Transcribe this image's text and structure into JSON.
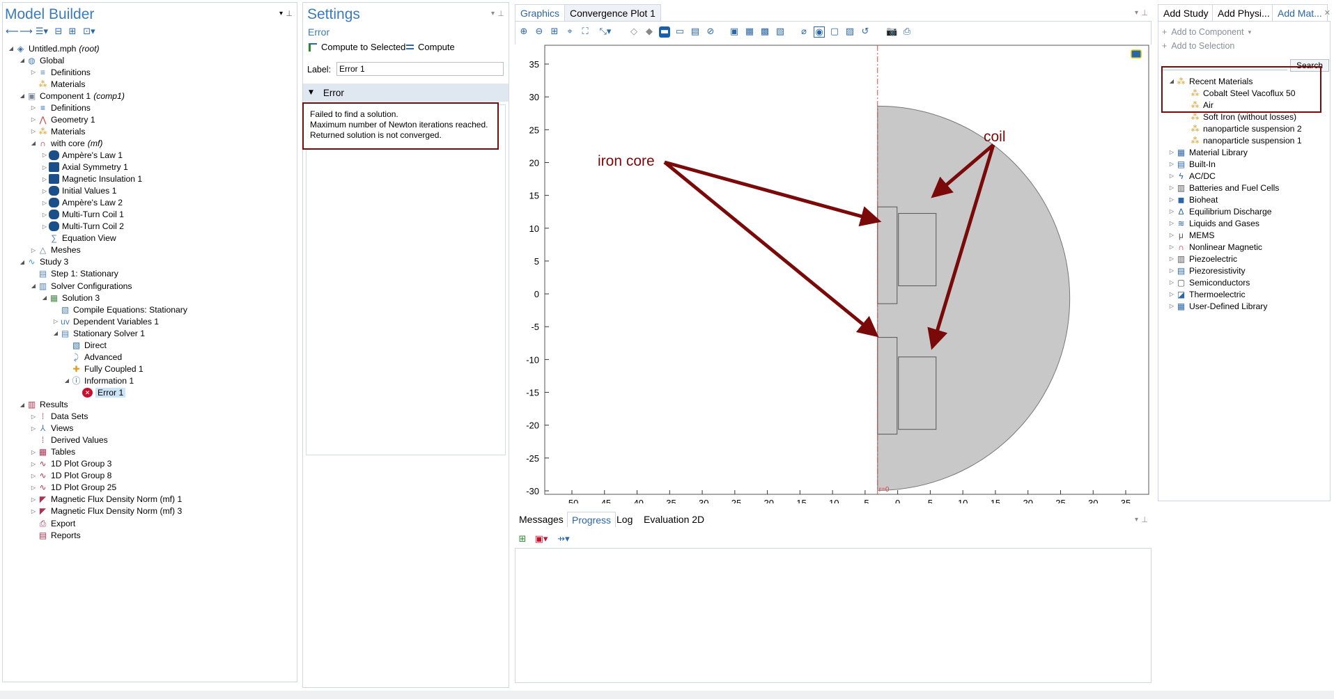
{
  "model_builder": {
    "title": "Model Builder",
    "tree": [
      {
        "label": "Untitled.mph",
        "suffix": "(root)",
        "level": 0,
        "twist": "open",
        "icon": "root-icon",
        "color": "#3a6ea5"
      },
      {
        "label": "Global",
        "level": 1,
        "twist": "open",
        "icon": "globe-icon",
        "color": "#4a7fb8"
      },
      {
        "label": "Definitions",
        "level": 2,
        "twist": "closed",
        "icon": "definitions-icon",
        "color": "#4a7fb8"
      },
      {
        "label": "Materials",
        "level": 2,
        "twist": "none",
        "icon": "materials-icon",
        "color": "#e69a1e"
      },
      {
        "label": "Component 1",
        "suffix": "(comp1)",
        "level": 1,
        "twist": "open",
        "icon": "component-icon",
        "color": "#7a8796"
      },
      {
        "label": "Definitions",
        "level": 2,
        "twist": "closed",
        "icon": "definitions-icon",
        "color": "#2a66a8"
      },
      {
        "label": "Geometry 1",
        "level": 2,
        "twist": "closed",
        "icon": "geometry-icon",
        "color": "#d23b2a"
      },
      {
        "label": "Materials",
        "level": 2,
        "twist": "closed",
        "icon": "materials-icon",
        "color": "#e69a1e"
      },
      {
        "label": "with core",
        "suffix": "(mf)",
        "level": 2,
        "twist": "open",
        "icon": "magnet-icon",
        "color": "#c8102e"
      },
      {
        "label": "Ampère's Law 1",
        "level": 3,
        "twist": "closed",
        "icon": "domain-node-icon",
        "color": "#1b4f8a"
      },
      {
        "label": "Axial Symmetry 1",
        "level": 3,
        "twist": "closed",
        "icon": "boundary-node-icon",
        "color": "#1b4f8a"
      },
      {
        "label": "Magnetic Insulation 1",
        "level": 3,
        "twist": "closed",
        "icon": "boundary-node-icon",
        "color": "#1b4f8a"
      },
      {
        "label": "Initial Values 1",
        "level": 3,
        "twist": "closed",
        "icon": "domain-node-icon",
        "color": "#1b4f8a"
      },
      {
        "label": "Ampère's Law 2",
        "level": 3,
        "twist": "closed",
        "icon": "domain-node-icon",
        "color": "#1b4f8a"
      },
      {
        "label": "Multi-Turn Coil 1",
        "level": 3,
        "twist": "closed",
        "icon": "domain-node-icon",
        "color": "#1b4f8a"
      },
      {
        "label": "Multi-Turn Coil 2",
        "level": 3,
        "twist": "closed",
        "icon": "domain-node-icon",
        "color": "#1b4f8a"
      },
      {
        "label": "Equation View",
        "level": 3,
        "twist": "none",
        "icon": "equation-view-icon",
        "color": "#4a7fb8"
      },
      {
        "label": "Meshes",
        "level": 2,
        "twist": "closed",
        "icon": "mesh-icon",
        "color": "#6b7b8c"
      },
      {
        "label": "Study 3",
        "level": 1,
        "twist": "open",
        "icon": "study-icon",
        "color": "#3a9ad9"
      },
      {
        "label": "Step 1: Stationary",
        "level": 2,
        "twist": "none",
        "icon": "step-icon",
        "color": "#4a7fb8"
      },
      {
        "label": "Solver Configurations",
        "level": 2,
        "twist": "open",
        "icon": "solver-config-icon",
        "color": "#4a7fb8"
      },
      {
        "label": "Solution 3",
        "level": 3,
        "twist": "open",
        "icon": "solution-icon",
        "color": "#4a8a4a"
      },
      {
        "label": "Compile Equations: Stationary",
        "level": 4,
        "twist": "none",
        "icon": "compile-icon",
        "color": "#4a7fb8"
      },
      {
        "label": "Dependent Variables 1",
        "level": 4,
        "twist": "closed",
        "icon": "dependent-variables-icon",
        "color": "#4a7fb8"
      },
      {
        "label": "Stationary Solver 1",
        "level": 4,
        "twist": "open",
        "icon": "stationary-solver-icon",
        "color": "#4a7fb8"
      },
      {
        "label": "Direct",
        "level": 5,
        "twist": "none",
        "icon": "direct-icon",
        "color": "#2a66a8"
      },
      {
        "label": "Advanced",
        "level": 5,
        "twist": "none",
        "icon": "advanced-icon",
        "color": "#4a7fb8"
      },
      {
        "label": "Fully Coupled 1",
        "level": 5,
        "twist": "none",
        "icon": "fully-coupled-icon",
        "color": "#e69a1e"
      },
      {
        "label": "Information 1",
        "level": 5,
        "twist": "open",
        "icon": "information-icon",
        "color": "#2a66a8"
      },
      {
        "label": "Error 1",
        "level": 6,
        "twist": "none",
        "icon": "error-icon",
        "color": "#c8102e",
        "selected": true
      },
      {
        "label": "Results",
        "level": 1,
        "twist": "open",
        "icon": "results-icon",
        "color": "#b03050"
      },
      {
        "label": "Data Sets",
        "level": 2,
        "twist": "closed",
        "icon": "data-sets-icon",
        "color": "#b03050"
      },
      {
        "label": "Views",
        "level": 2,
        "twist": "closed",
        "icon": "views-icon",
        "color": "#4a7fb8"
      },
      {
        "label": "Derived Values",
        "level": 2,
        "twist": "none",
        "icon": "derived-values-icon",
        "color": "#b03050"
      },
      {
        "label": "Tables",
        "level": 2,
        "twist": "closed",
        "icon": "tables-icon",
        "color": "#b03050"
      },
      {
        "label": "1D Plot Group 3",
        "level": 2,
        "twist": "closed",
        "icon": "plot-1d-icon",
        "color": "#b03050"
      },
      {
        "label": "1D Plot Group 8",
        "level": 2,
        "twist": "closed",
        "icon": "plot-1d-icon",
        "color": "#b03050"
      },
      {
        "label": "1D Plot Group 25",
        "level": 2,
        "twist": "closed",
        "icon": "plot-1d-icon",
        "color": "#b03050"
      },
      {
        "label": "Magnetic Flux Density Norm (mf) 1",
        "level": 2,
        "twist": "closed",
        "icon": "plot-2d-icon",
        "color": "#b03050"
      },
      {
        "label": "Magnetic Flux Density Norm (mf) 3",
        "level": 2,
        "twist": "closed",
        "icon": "plot-2d-icon",
        "color": "#b03050"
      },
      {
        "label": "Export",
        "level": 2,
        "twist": "none",
        "icon": "export-icon",
        "color": "#b03050"
      },
      {
        "label": "Reports",
        "level": 2,
        "twist": "none",
        "icon": "reports-icon",
        "color": "#b03050"
      }
    ]
  },
  "settings": {
    "title": "Settings",
    "subtitle": "Error",
    "compute_selected": "Compute to Selected",
    "compute": "Compute",
    "label_caption": "Label:",
    "label_value": "Error 1",
    "section": "Error",
    "message_lines": [
      "Failed to find a solution.",
      "Maximum number of Newton iterations reached.",
      "Returned solution is not converged."
    ]
  },
  "graphics": {
    "tabs": [
      "Graphics",
      "Convergence Plot 1"
    ],
    "y_ticks": [
      "35",
      "30",
      "25",
      "20",
      "15",
      "10",
      "5",
      "0",
      "-5",
      "-10",
      "-15",
      "-20",
      "-25",
      "-30"
    ],
    "x_ticks": [
      "-50",
      "-45",
      "-40",
      "-35",
      "-30",
      "-25",
      "-20",
      "-15",
      "-10",
      "-5",
      "0",
      "5",
      "10",
      "15",
      "20",
      "25",
      "30",
      "35"
    ],
    "axis_marker": "r=0",
    "annotation_core": "iron core",
    "annotation_coil": "coil",
    "annotation_color": "#7a0a0a",
    "domain_fill": "#c8c8c8"
  },
  "messages": {
    "tabs": [
      "Messages",
      "Progress",
      "Log",
      "Evaluation 2D"
    ],
    "active": "Progress"
  },
  "add_material": {
    "tabs": [
      "Add Study",
      "Add Physi...",
      "Add Mat..."
    ],
    "add_to_component": "Add to Component",
    "add_to_selection": "Add to Selection",
    "search": "Search",
    "recent_title": "Recent Materials",
    "recent": [
      "Cobalt Steel Vacoflux 50",
      "Air",
      "Soft Iron (without losses)",
      "nanoparticle suspension 2",
      "nanoparticle suspension 1"
    ],
    "libraries": [
      "Material Library",
      "Built-In",
      "AC/DC",
      "Batteries and Fuel Cells",
      "Bioheat",
      "Equilibrium Discharge",
      "Liquids and Gases",
      "MEMS",
      "Nonlinear Magnetic",
      "Piezoelectric",
      "Piezoresistivity",
      "Semiconductors",
      "Thermoelectric",
      "User-Defined Library"
    ]
  },
  "highlight_color": "#7a0a0a"
}
